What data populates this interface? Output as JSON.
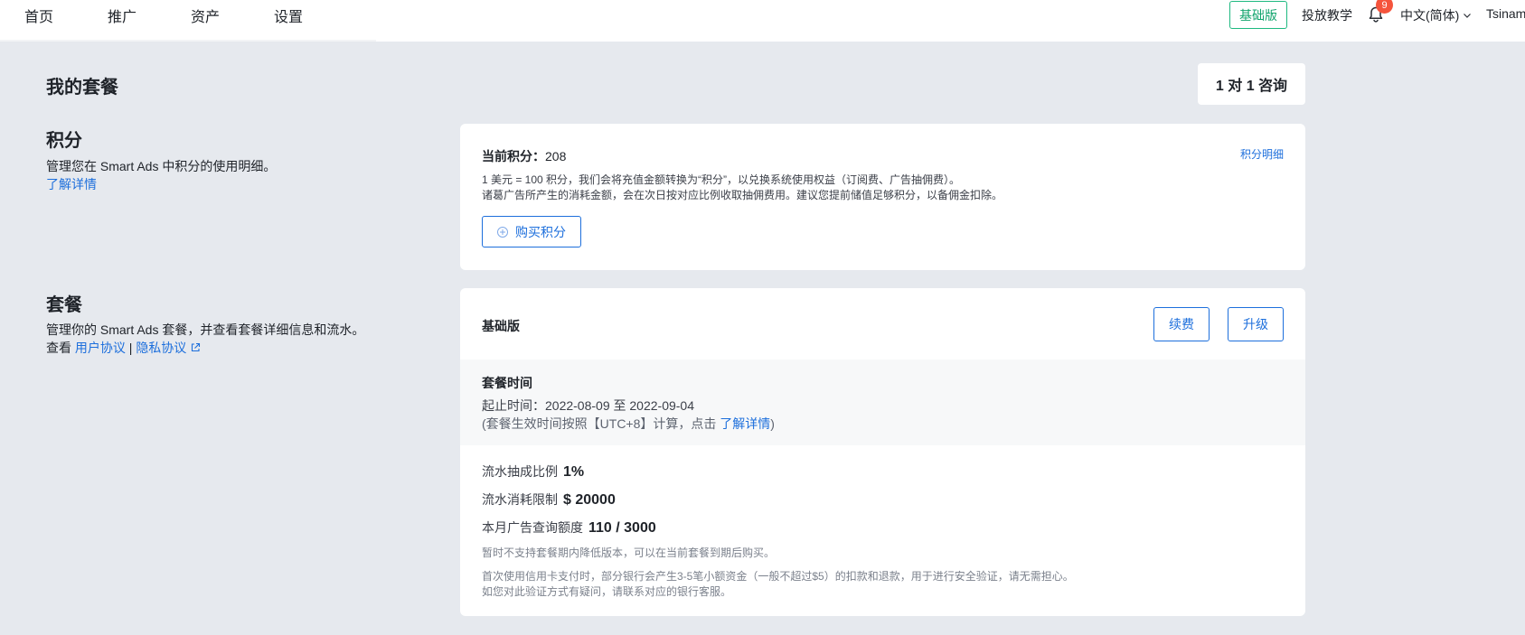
{
  "nav": {
    "items": [
      {
        "label": "首页"
      },
      {
        "label": "推广"
      },
      {
        "label": "资产"
      },
      {
        "label": "设置"
      }
    ],
    "plan_badge": "基础版",
    "tutorial": "投放教学",
    "notification_count": "9",
    "language": "中文(简体)",
    "user": "Tsinam"
  },
  "page": {
    "title": "我的套餐",
    "consult_button": "1 对 1 咨询"
  },
  "points_section": {
    "title": "积分",
    "desc": "管理您在 Smart Ads 中积分的使用明细。",
    "learn_more": "了解详情",
    "current_label": "当前积分：",
    "current_value": "208",
    "detail_link": "积分明细",
    "line1": "1 美元 = 100 积分，我们会将充值金额转换为“积分”，以兑换系统使用权益（订阅费、广告抽佣费）。",
    "line2": "诸葛广告所产生的消耗金额，会在次日按对应比例收取抽佣费用。建议您提前储值足够积分，以备佣金扣除。",
    "buy_button": "购买积分"
  },
  "plan_section": {
    "title": "套餐",
    "desc": "管理你的 Smart Ads 套餐，并查看套餐详细信息和流水。",
    "view_prefix": "查看",
    "user_agreement": "用户协议",
    "separator": "|",
    "privacy_policy": "隐私协议",
    "plan_name": "基础版",
    "renew_button": "续费",
    "upgrade_button": "升级",
    "time_title": "套餐时间",
    "time_range_label": "起止时间：",
    "time_range_value": "2022-08-09 至 2022-09-04",
    "time_note_prefix": "(套餐生效时间按照【UTC+8】计算，点击",
    "time_note_link": "了解详情",
    "time_note_suffix": ")",
    "commission_label": "流水抽成比例",
    "commission_value": "1%",
    "spend_limit_label": "流水消耗限制",
    "spend_limit_value": "$ 20000",
    "query_label": "本月广告查询额度",
    "query_value": "110 / 3000",
    "note1": "暂时不支持套餐期内降低版本，可以在当前套餐到期后购买。",
    "note2": "首次使用信用卡支付时，部分银行会产生3-5笔小额资金（一般不超过$5）的扣款和退款，用于进行安全验证，请无需担心。",
    "note3": "如您对此验证方式有疑问，请联系对应的银行客服。"
  },
  "colors": {
    "accent": "#1d6fdc",
    "badge_green": "#10a36c",
    "notification_red": "#f5543c",
    "background": "#e6e9ee"
  }
}
